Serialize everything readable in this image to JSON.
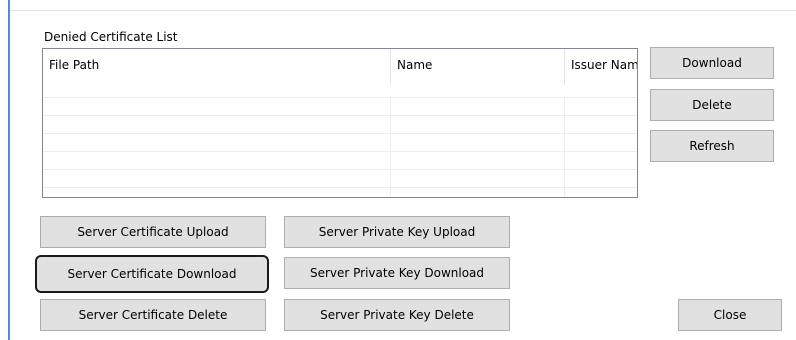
{
  "group": {
    "label": "Denied Certificate List"
  },
  "list": {
    "columns": [
      "File Path",
      "Name",
      "Issuer Nam"
    ]
  },
  "side_buttons": {
    "download": "Download",
    "delete": "Delete",
    "refresh": "Refresh"
  },
  "bottom_buttons": {
    "server_cert_upload": "Server Certificate Upload",
    "server_key_upload": "Server Private Key Upload",
    "server_cert_download": "Server Certificate Download",
    "server_key_download": "Server Private Key Download",
    "server_cert_delete": "Server Certificate Delete",
    "server_key_delete": "Server Private Key Delete",
    "close": "Close"
  }
}
